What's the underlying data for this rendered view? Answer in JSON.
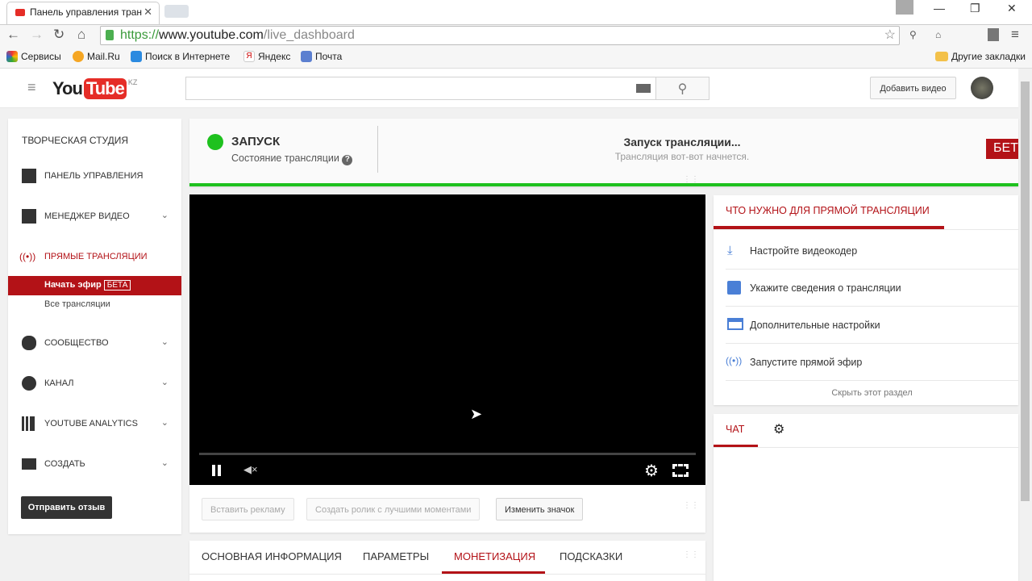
{
  "browser": {
    "tab_title": "Панель управления тран",
    "url_scheme": "https://",
    "url_domain": "www.youtube.com",
    "url_path": "/live_dashboard",
    "bookmarks": [
      "Сервисы",
      "Mail.Ru",
      "Поиск в Интернете",
      "Яндекс",
      "Почта"
    ],
    "other_bookmarks": "Другие закладки"
  },
  "header": {
    "logo_you": "You",
    "logo_tube": "Tube",
    "region": "KZ",
    "upload_label": "Добавить видео"
  },
  "sidebar": {
    "title": "ТВОРЧЕСКАЯ СТУДИЯ",
    "items": [
      {
        "label": "ПАНЕЛЬ УПРАВЛЕНИЯ"
      },
      {
        "label": "МЕНЕДЖЕР ВИДЕО"
      },
      {
        "label": "ПРЯМЫЕ ТРАНСЛЯЦИИ"
      },
      {
        "label": "СООБЩЕСТВО"
      },
      {
        "label": "КАНАЛ"
      },
      {
        "label": "YOUTUBE ANALYTICS"
      },
      {
        "label": "СОЗДАТЬ"
      }
    ],
    "sub_active": "Начать эфир",
    "sub_badge": "БЕТА",
    "sub_other": "Все трансляции",
    "feedback": "Отправить отзыв"
  },
  "status": {
    "state": "ЗАПУСК",
    "label": "Состояние трансляции",
    "message": "Запуск трансляции...",
    "sub": "Трансляция вот-вот начнется.",
    "beta": "БЕТ",
    "color": "#1ec11e"
  },
  "actions": [
    "Вставить рекламу",
    "Создать ролик с лучшими моментами",
    "Изменить значок"
  ],
  "tabs": [
    "ОСНОВНАЯ ИНФОРМАЦИЯ",
    "ПАРАМЕТРЫ",
    "МОНЕТИЗАЦИЯ",
    "ПОДСКАЗКИ"
  ],
  "checklist": {
    "title": "ЧТО НУЖНО ДЛЯ ПРЯМОЙ ТРАНСЛЯЦИИ",
    "items": [
      "Настройте видеокодер",
      "Укажите сведения о трансляции",
      "Дополнительные настройки",
      "Запустите прямой эфир"
    ],
    "hide": "Скрыть этот раздел"
  },
  "chat": {
    "tab": "ЧАТ"
  },
  "accent": "#b31217"
}
